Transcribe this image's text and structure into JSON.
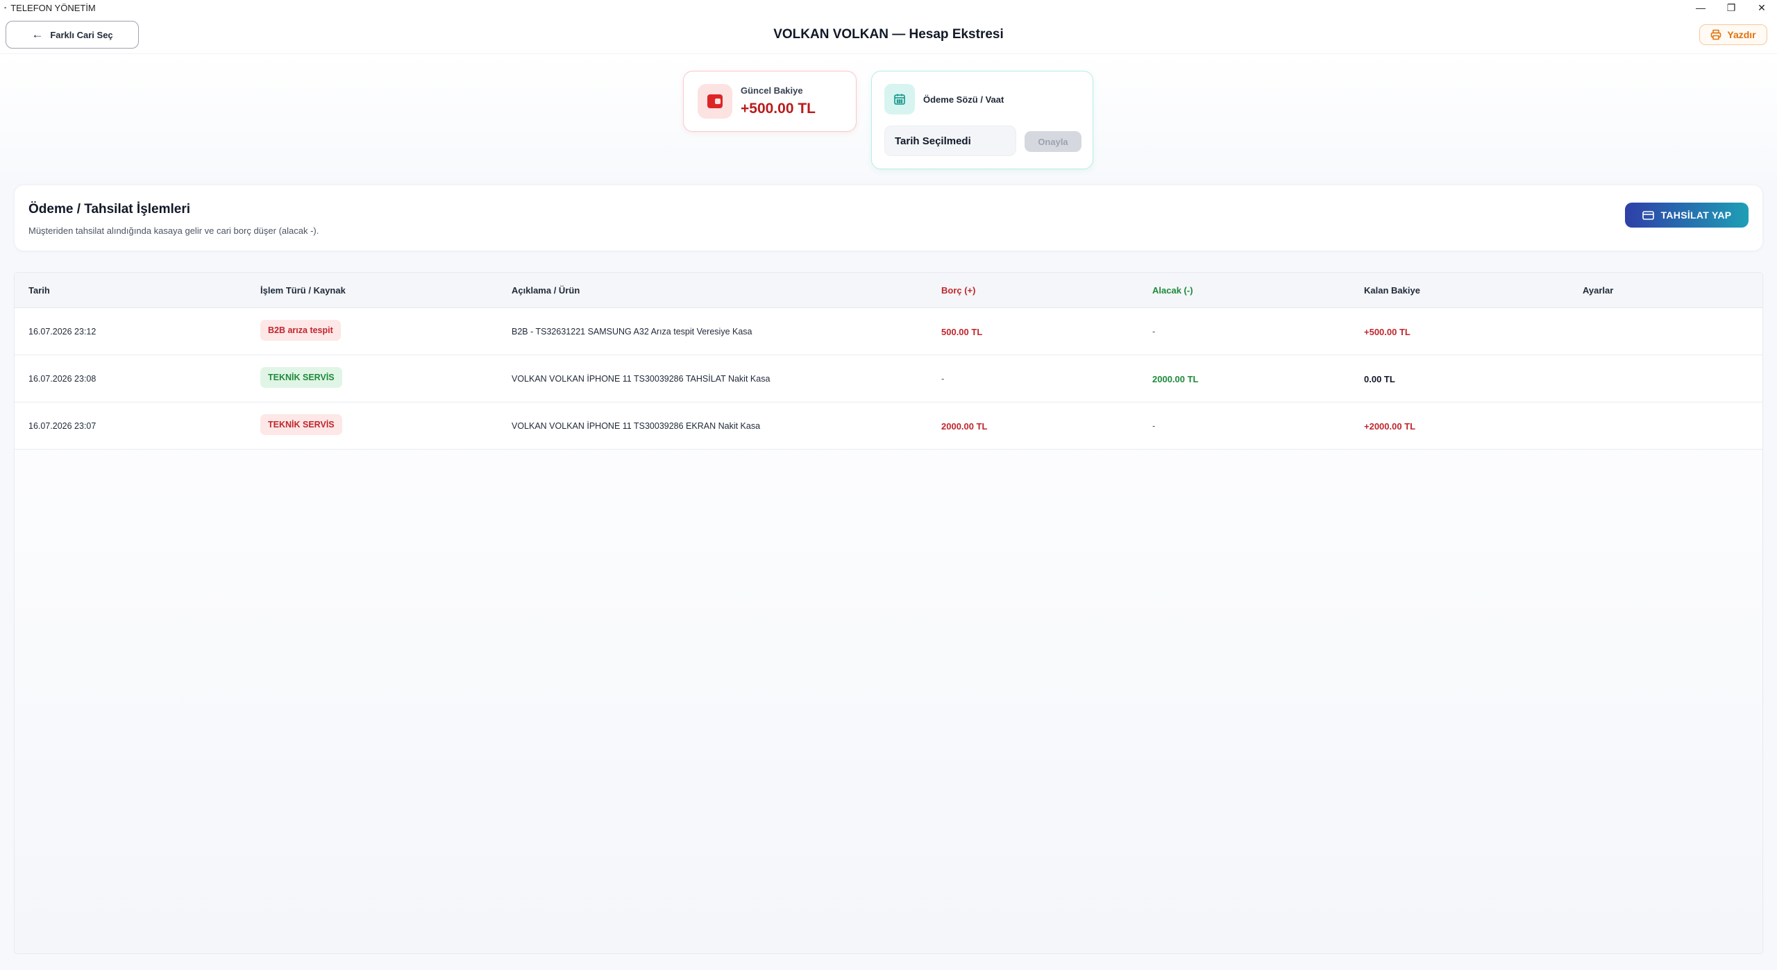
{
  "window": {
    "title": "TELEFON YÖNETİM",
    "minimize": "—",
    "restore": "❐",
    "close": "✕"
  },
  "header": {
    "back_label": "Farklı Cari Seç",
    "title": "VOLKAN VOLKAN — Hesap Ekstresi",
    "print_label": "Yazdır"
  },
  "balance": {
    "label": "Güncel Bakiye",
    "value": "+500.00 TL"
  },
  "promise": {
    "label": "Ödeme Sözü / Vaat",
    "date_value": "Tarih Seçilmedi",
    "confirm_label": "Onayla"
  },
  "section": {
    "title": "Ödeme / Tahsilat İşlemleri",
    "description": "Müşteriden tahsilat alındığında kasaya gelir ve cari borç düşer (alacak -).",
    "collect_label": "TAHSİLAT YAP"
  },
  "table": {
    "columns": [
      "Tarih",
      "İşlem Türü / Kaynak",
      "Açıklama / Ürün",
      "Borç (+)",
      "Alacak (-)",
      "Kalan Bakiye",
      "Ayarlar"
    ],
    "rows": [
      {
        "date": "16.07.2026 23:12",
        "type": "B2B arıza tespit",
        "type_color": "red",
        "description": "B2B - TS32631221 SAMSUNG A32 Arıza tespit Veresiye Kasa",
        "debit": "500.00 TL",
        "credit": "-",
        "balance": "+500.00 TL",
        "balance_color": "red"
      },
      {
        "date": "16.07.2026 23:08",
        "type": "TEKNİK SERVİS",
        "type_color": "green",
        "description": "VOLKAN VOLKAN İPHONE 11 TS30039286 TAHSİLAT Nakit Kasa",
        "debit": "-",
        "credit": "2000.00 TL",
        "balance": "0.00 TL",
        "balance_color": "dark"
      },
      {
        "date": "16.07.2026 23:07",
        "type": "TEKNİK SERVİS",
        "type_color": "red",
        "description": "VOLKAN VOLKAN İPHONE 11 TS30039286 EKRAN Nakit Kasa",
        "debit": "2000.00 TL",
        "credit": "-",
        "balance": "+2000.00 TL",
        "balance_color": "red"
      }
    ]
  },
  "colors": {
    "debit": "#c0262d",
    "credit": "#1e8a3a",
    "accent_start": "#2f3fa8",
    "accent_end": "#1e9fb5",
    "print": "#e0730f"
  }
}
